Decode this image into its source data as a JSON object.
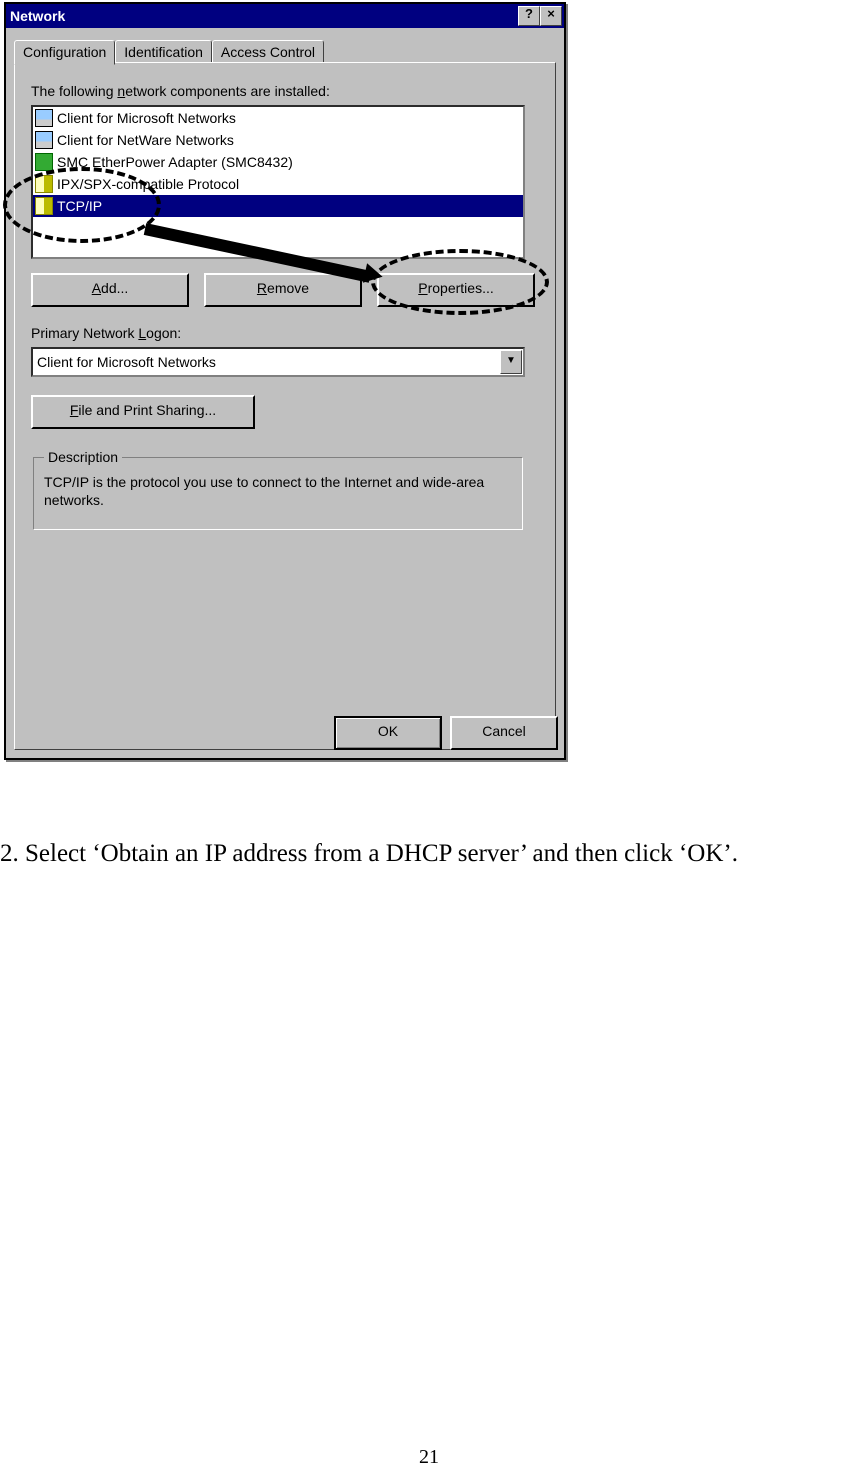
{
  "dialog": {
    "title": "Network",
    "help_btn": "?",
    "close_btn": "×",
    "tabs": [
      "Configuration",
      "Identification",
      "Access Control"
    ],
    "components_label": "The following network components are installed:",
    "components_label_prefix": "The following ",
    "components_label_underline": "n",
    "components_label_suffix": "etwork components are installed:",
    "components": {
      "item0": "Client for Microsoft Networks",
      "item1": "Client for NetWare Networks",
      "item2": "SMC EtherPower Adapter (SMC8432)",
      "item3": "IPX/SPX-compatible Protocol",
      "item4": "TCP/IP"
    },
    "buttons": {
      "add_u": "A",
      "add_rest": "dd...",
      "remove_u": "R",
      "remove_rest": "emove",
      "prop_u": "P",
      "prop_rest": "roperties..."
    },
    "logon_label_prefix": "Primary Network ",
    "logon_label_u": "L",
    "logon_label_suffix": "ogon:",
    "logon_value": "Client for Microsoft Networks",
    "share_u": "F",
    "share_rest": "ile and Print Sharing...",
    "desc_legend": "Description",
    "desc_text": "TCP/IP is the protocol you use to connect to the Internet and wide-area networks.",
    "ok": "OK",
    "cancel": "Cancel"
  },
  "instruction": "2. Select ‘Obtain an IP address from a DHCP server’ and then click ‘OK’.",
  "page_number": "21"
}
